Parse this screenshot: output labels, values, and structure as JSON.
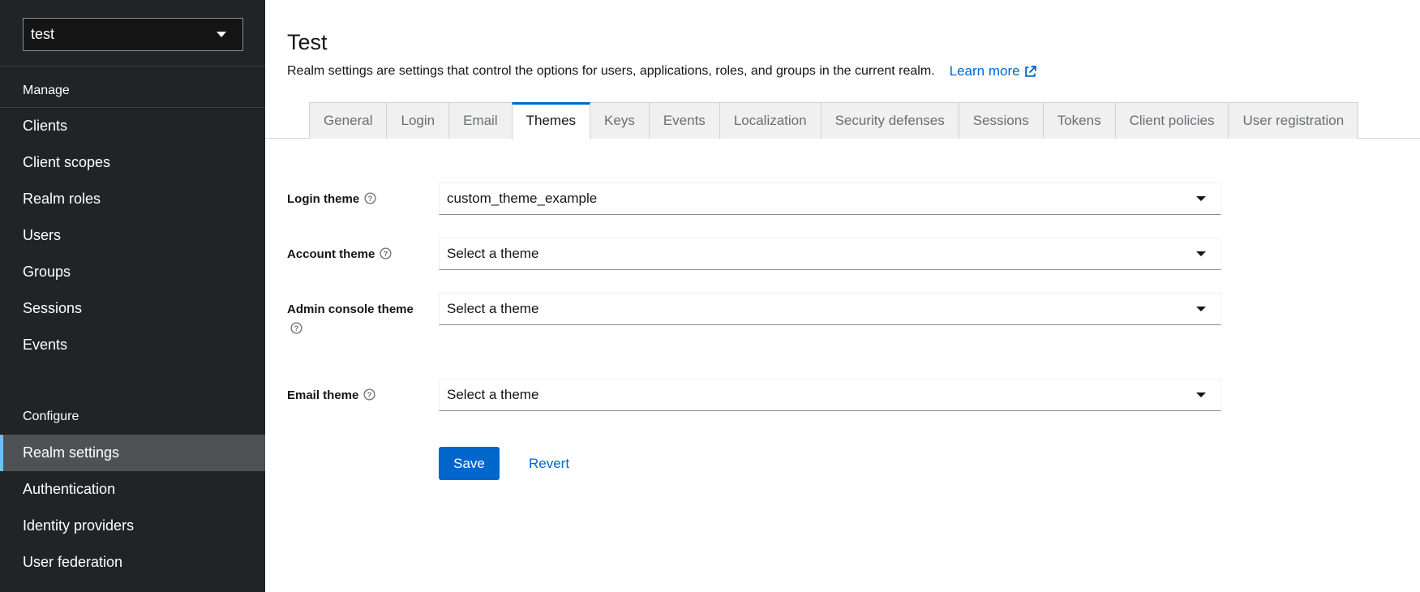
{
  "sidebar": {
    "realm_selector": {
      "value": "test"
    },
    "manage_title": "Manage",
    "manage_items": [
      {
        "label": "Clients"
      },
      {
        "label": "Client scopes"
      },
      {
        "label": "Realm roles"
      },
      {
        "label": "Users"
      },
      {
        "label": "Groups"
      },
      {
        "label": "Sessions"
      },
      {
        "label": "Events"
      }
    ],
    "configure_title": "Configure",
    "configure_items": [
      {
        "label": "Realm settings",
        "active": true
      },
      {
        "label": "Authentication"
      },
      {
        "label": "Identity providers"
      },
      {
        "label": "User federation"
      }
    ]
  },
  "header": {
    "title": "Test",
    "description": "Realm settings are settings that control the options for users, applications, roles, and groups in the current realm.",
    "learn_more": "Learn more"
  },
  "tabs": [
    {
      "label": "General"
    },
    {
      "label": "Login"
    },
    {
      "label": "Email"
    },
    {
      "label": "Themes",
      "active": true
    },
    {
      "label": "Keys"
    },
    {
      "label": "Events"
    },
    {
      "label": "Localization"
    },
    {
      "label": "Security defenses"
    },
    {
      "label": "Sessions"
    },
    {
      "label": "Tokens"
    },
    {
      "label": "Client policies"
    },
    {
      "label": "User registration"
    }
  ],
  "form": {
    "login_theme": {
      "label": "Login theme",
      "value": "custom_theme_example"
    },
    "account_theme": {
      "label": "Account theme",
      "value": "Select a theme"
    },
    "admin_console_theme": {
      "label": "Admin console theme",
      "value": "Select a theme"
    },
    "email_theme": {
      "label": "Email theme",
      "value": "Select a theme"
    }
  },
  "actions": {
    "save": "Save",
    "revert": "Revert"
  },
  "colors": {
    "sidebar_bg": "#212427",
    "active_item_bg": "#4f5255",
    "accent": "#0066cc"
  }
}
